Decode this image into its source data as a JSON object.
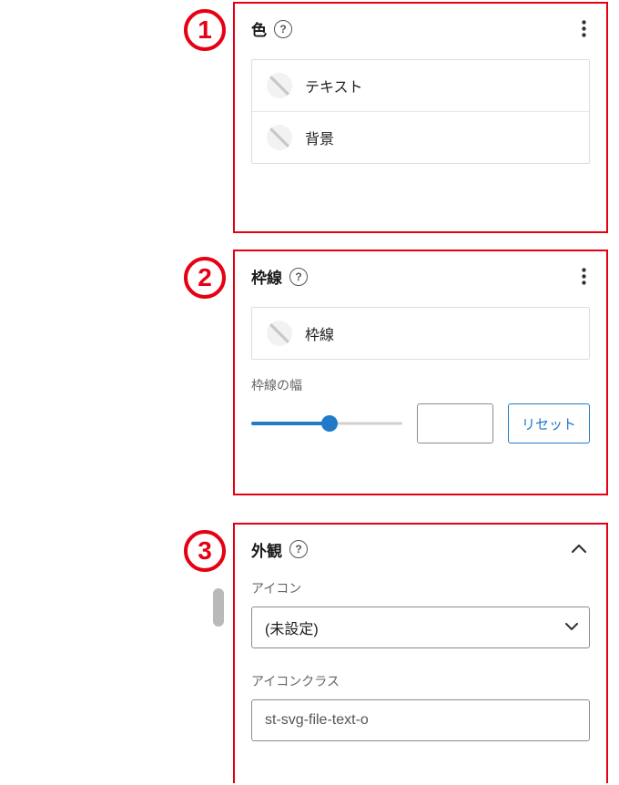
{
  "annotations": {
    "n1": "1",
    "n2": "2",
    "n3": "3"
  },
  "panels": {
    "color": {
      "title": "色",
      "items": [
        {
          "label": "テキスト"
        },
        {
          "label": "背景"
        }
      ]
    },
    "border": {
      "title": "枠線",
      "items": [
        {
          "label": "枠線"
        }
      ],
      "widthLabel": "枠線の幅",
      "widthValue": "",
      "resetLabel": "リセット"
    },
    "appearance": {
      "title": "外観",
      "iconLabel": "アイコン",
      "iconValue": "(未設定)",
      "iconClassLabel": "アイコンクラス",
      "iconClassValue": "st-svg-file-text-o"
    }
  }
}
